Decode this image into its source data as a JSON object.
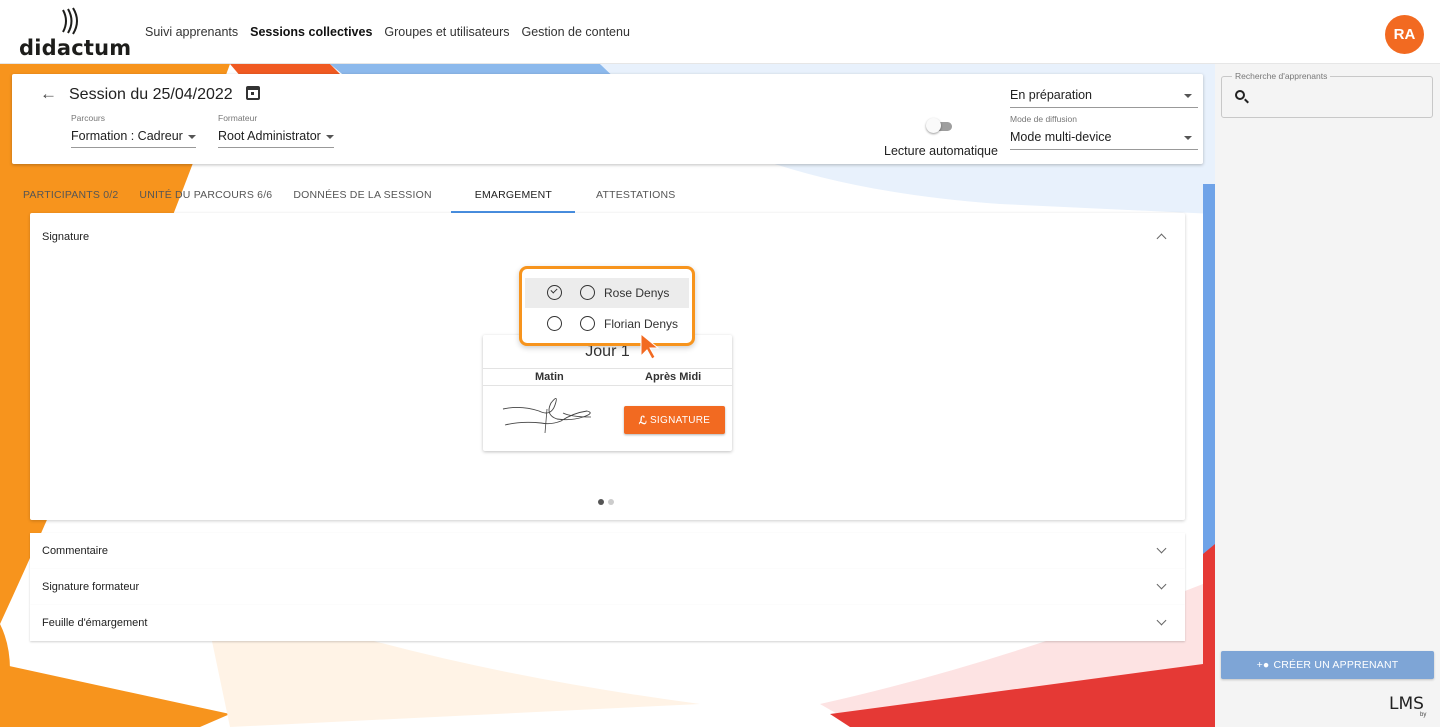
{
  "app": {
    "logo_text": "didactum",
    "avatar_initials": "RA",
    "brand_color": "#f26a21"
  },
  "nav": {
    "items": [
      {
        "label": "Suivi apprenants",
        "active": false
      },
      {
        "label": "Sessions collectives",
        "active": true
      },
      {
        "label": "Groupes et utilisateurs",
        "active": false
      },
      {
        "label": "Gestion de contenu",
        "active": false
      }
    ]
  },
  "session": {
    "title": "Session du 25/04/2022",
    "parcours_label": "Parcours",
    "parcours_value": "Formation : Cadreur",
    "formateur_label": "Formateur",
    "formateur_value": "Root Administrator",
    "auto_play_label": "Lecture automatique",
    "auto_play_on": false,
    "status_value": "En préparation",
    "diffusion_label": "Mode de diffusion",
    "diffusion_value": "Mode multi-device"
  },
  "tabs": [
    {
      "label": "PARTICIPANTS 0/2",
      "active": false
    },
    {
      "label": "UNITÉ DU PARCOURS 6/6",
      "active": false
    },
    {
      "label": "DONNÉES DE LA SESSION",
      "active": false
    },
    {
      "label": "EMARGEMENT",
      "active": true
    },
    {
      "label": "ATTESTATIONS",
      "active": false
    }
  ],
  "signature_panel": {
    "title": "Signature",
    "day_title": "Jour 1",
    "col_morning": "Matin",
    "col_afternoon": "Après Midi",
    "sign_button": "SIGNATURE",
    "carousel_pages": 2,
    "carousel_active": 1
  },
  "participants_popover": {
    "items": [
      {
        "name": "Rose Denys",
        "signed": true
      },
      {
        "name": "Florian Denys",
        "signed": false
      }
    ]
  },
  "accordions": [
    {
      "title": "Commentaire"
    },
    {
      "title": "Signature formateur"
    },
    {
      "title": "Feuille d'émargement"
    }
  ],
  "right_panel": {
    "search_label": "Recherche d'apprenants",
    "search_value": "",
    "create_button": "CRÉER UN APPRENANT",
    "create_button_color": "#7ea5d6"
  },
  "footer": {
    "lms_text": "LMS",
    "lms_by": "by"
  }
}
